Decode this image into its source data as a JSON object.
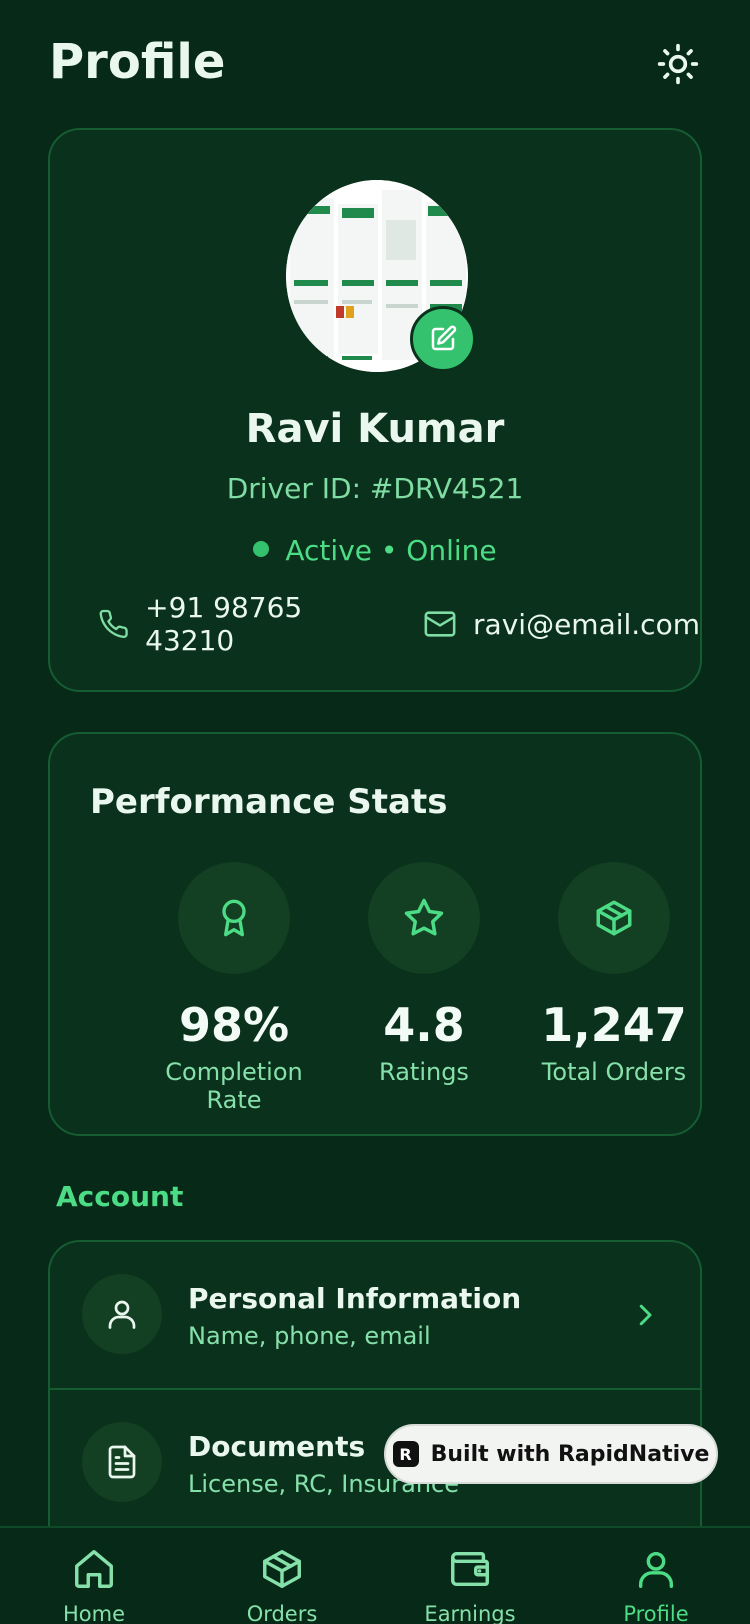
{
  "header": {
    "title": "Profile",
    "theme_icon": "sun-icon"
  },
  "profile": {
    "name": "Ravi Kumar",
    "driver_id": "Driver ID: #DRV4521",
    "status": "Active • Online",
    "phone": "+91 98765 43210",
    "email": "ravi@email.com"
  },
  "stats": {
    "title": "Performance Stats",
    "items": [
      {
        "value": "98%",
        "label": "Completion Rate",
        "icon": "award-icon"
      },
      {
        "value": "4.8",
        "label": "Ratings",
        "icon": "star-icon"
      },
      {
        "value": "1,247",
        "label": "Total Orders",
        "icon": "package-icon"
      }
    ]
  },
  "account": {
    "heading": "Account",
    "items": [
      {
        "title": "Personal Information",
        "subtitle": "Name, phone, email",
        "icon": "user-icon"
      },
      {
        "title": "Documents",
        "subtitle": "License, RC, Insurance",
        "icon": "document-icon"
      }
    ]
  },
  "badge": {
    "label": "Built with RapidNative"
  },
  "tabs": [
    {
      "label": "Home",
      "icon": "home-icon"
    },
    {
      "label": "Orders",
      "icon": "package-icon"
    },
    {
      "label": "Earnings",
      "icon": "wallet-icon"
    },
    {
      "label": "Profile",
      "icon": "user-icon",
      "active": true
    }
  ],
  "colors": {
    "background": "#062a17",
    "card": "#0a311b",
    "accent": "#34c26e",
    "accent_text": "#4ddc86"
  }
}
